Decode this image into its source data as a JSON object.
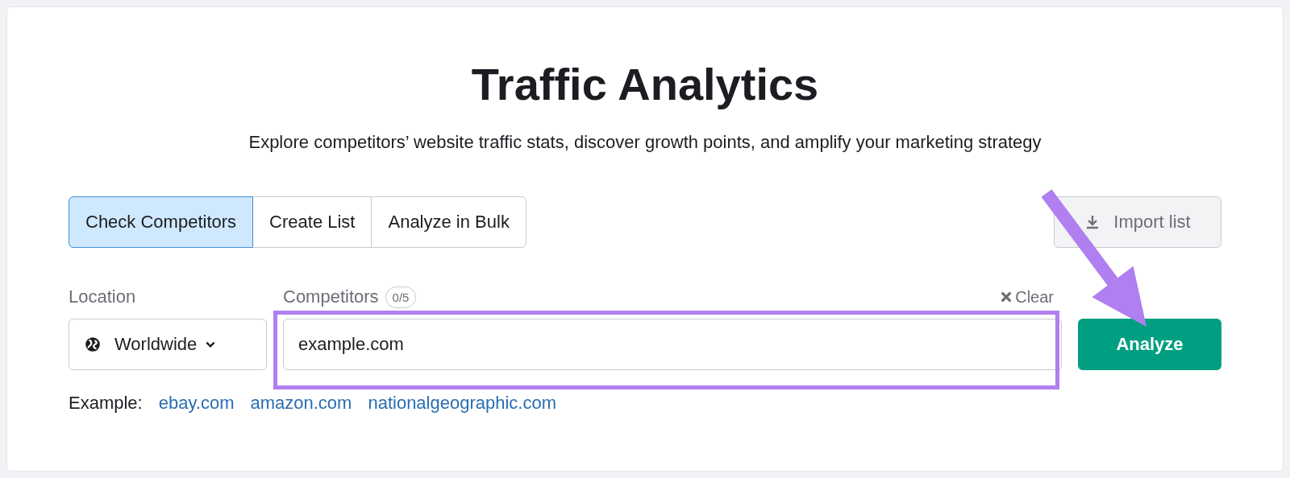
{
  "title": "Traffic Analytics",
  "subtitle": "Explore competitors’ website traffic stats, discover growth points, and amplify your marketing strategy",
  "tabs": [
    {
      "label": "Check Competitors",
      "selected": true
    },
    {
      "label": "Create List",
      "selected": false
    },
    {
      "label": "Analyze in Bulk",
      "selected": false
    }
  ],
  "import_button": "Import list",
  "location": {
    "label": "Location",
    "value": "Worldwide"
  },
  "competitors": {
    "label": "Competitors",
    "count": "0/5",
    "clear": "Clear",
    "value": "example.com"
  },
  "analyze_button": "Analyze",
  "examples": {
    "label": "Example:",
    "links": [
      "ebay.com",
      "amazon.com",
      "nationalgeographic.com"
    ]
  }
}
